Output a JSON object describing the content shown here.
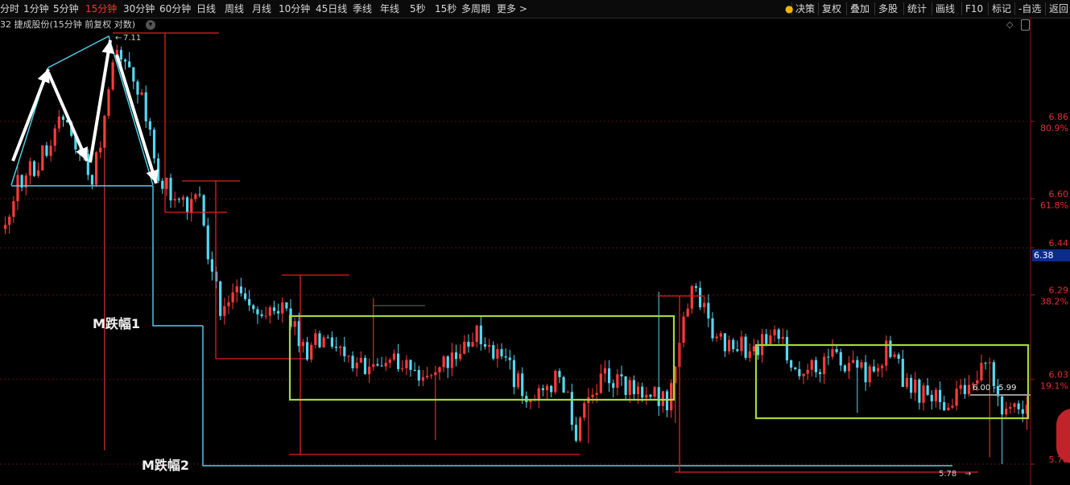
{
  "toolbar": {
    "left_items": [
      {
        "label": "分时",
        "x": 0,
        "active": false
      },
      {
        "label": "1分钟",
        "x": 29,
        "active": false
      },
      {
        "label": "5分钟",
        "x": 66,
        "active": false
      },
      {
        "label": "15分钟",
        "x": 106,
        "active": true
      },
      {
        "label": "30分钟",
        "x": 153,
        "active": false
      },
      {
        "label": "60分钟",
        "x": 198,
        "active": false
      },
      {
        "label": "日线",
        "x": 244,
        "active": false
      },
      {
        "label": "周线",
        "x": 279,
        "active": false
      },
      {
        "label": "月线",
        "x": 313,
        "active": false
      },
      {
        "label": "10分钟",
        "x": 346,
        "active": false
      },
      {
        "label": "45日线",
        "x": 392,
        "active": false
      },
      {
        "label": "季线",
        "x": 438,
        "active": false
      },
      {
        "label": "年线",
        "x": 472,
        "active": false
      },
      {
        "label": "5秒",
        "x": 509,
        "active": false
      },
      {
        "label": "15秒",
        "x": 540,
        "active": false
      },
      {
        "label": "多周期",
        "x": 573,
        "active": false
      },
      {
        "label": "更多 >",
        "x": 617,
        "active": false
      }
    ],
    "right_items": [
      {
        "label": "决策",
        "x": 988,
        "active": false
      },
      {
        "label": "复权",
        "x": 1021,
        "active": false
      },
      {
        "label": "叠加",
        "x": 1056,
        "active": false
      },
      {
        "label": "多股",
        "x": 1091,
        "active": false
      },
      {
        "label": "统计",
        "x": 1127,
        "active": false
      },
      {
        "label": "画线",
        "x": 1162,
        "active": false
      },
      {
        "label": "F10",
        "x": 1199,
        "active": false
      },
      {
        "label": "标记",
        "x": 1232,
        "active": false
      },
      {
        "label": "-自选",
        "x": 1265,
        "active": false
      },
      {
        "label": "返回",
        "x": 1303,
        "active": false
      }
    ]
  },
  "chart_title": "32 捷成股份(15分钟 前复权 对数)",
  "current_price": "6.38",
  "chart_data": {
    "type": "candlestick",
    "y_scale": "log",
    "ylim": [
      5.75,
      7.17
    ],
    "y_ticks": [
      {
        "value": 6.86,
        "label": "6.86",
        "pct": "80.9%"
      },
      {
        "value": 6.6,
        "label": "6.60",
        "pct": "61.8%"
      },
      {
        "value": 6.44,
        "label": "6.44",
        "pct": ""
      },
      {
        "value": 6.29,
        "label": "6.29",
        "pct": "38.2%"
      },
      {
        "value": 6.03,
        "label": "6.03",
        "pct": "19.1%"
      },
      {
        "value": 5.78,
        "label": "5.78",
        "pct": ""
      }
    ],
    "high_marker": "7.11",
    "low_marker": "5.78",
    "range_marker": "6.00 - 5.99",
    "annotations": [
      "M跌幅1",
      "M跌幅2"
    ],
    "n_bars": 248,
    "anchors": [
      [
        0,
        6.5
      ],
      [
        3,
        6.64
      ],
      [
        10,
        6.76
      ],
      [
        14,
        6.89
      ],
      [
        18,
        6.75
      ],
      [
        21,
        6.64
      ],
      [
        26,
        7.06
      ],
      [
        29,
        7.11
      ],
      [
        33,
        6.93
      ],
      [
        38,
        6.64
      ],
      [
        44,
        6.58
      ],
      [
        47,
        6.6
      ],
      [
        49,
        6.4
      ],
      [
        52,
        6.25
      ],
      [
        56,
        6.33
      ],
      [
        62,
        6.22
      ],
      [
        68,
        6.24
      ],
      [
        72,
        6.12
      ],
      [
        78,
        6.15
      ],
      [
        86,
        6.06
      ],
      [
        94,
        6.1
      ],
      [
        100,
        6.03
      ],
      [
        108,
        6.1
      ],
      [
        114,
        6.18
      ],
      [
        120,
        6.1
      ],
      [
        126,
        5.98
      ],
      [
        134,
        6.04
      ],
      [
        138,
        5.88
      ],
      [
        144,
        6.04
      ],
      [
        150,
        6.01
      ],
      [
        160,
        5.96
      ],
      [
        166,
        6.32
      ],
      [
        172,
        6.15
      ],
      [
        180,
        6.12
      ],
      [
        186,
        6.16
      ],
      [
        192,
        6.05
      ],
      [
        200,
        6.1
      ],
      [
        208,
        6.04
      ],
      [
        214,
        6.13
      ],
      [
        218,
        6.01
      ],
      [
        224,
        5.96
      ],
      [
        232,
        5.98
      ],
      [
        238,
        6.1
      ],
      [
        241,
        5.9
      ],
      [
        244,
        5.98
      ],
      [
        248,
        5.92
      ]
    ],
    "extremes": [
      [
        27,
        7.11
      ],
      [
        24,
        5.82
      ],
      [
        89,
        6.28
      ],
      [
        104,
        5.85
      ],
      [
        141,
        5.84
      ],
      [
        158,
        6.3
      ],
      [
        162,
        5.9
      ],
      [
        206,
        5.93
      ],
      [
        238,
        5.8
      ],
      [
        241,
        5.78
      ],
      [
        247,
        5.88
      ]
    ]
  }
}
